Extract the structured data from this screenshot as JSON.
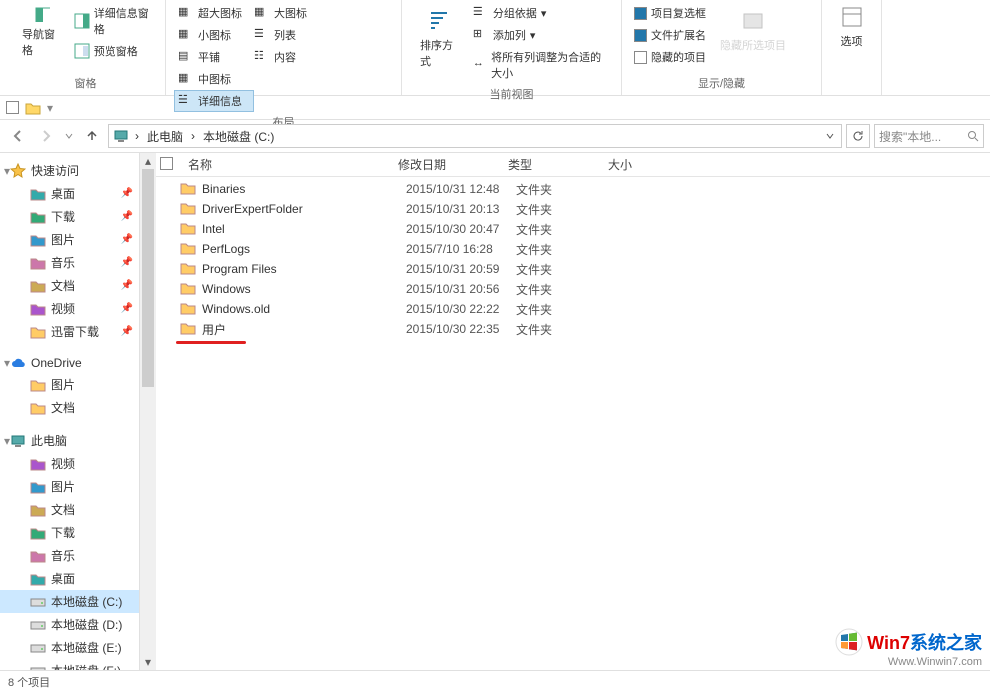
{
  "ribbon": {
    "panes": {
      "label": "窗格",
      "nav_pane": "导航窗格",
      "detail_pane": "详细信息窗格",
      "preview_pane": "预览窗格"
    },
    "layout": {
      "label": "布局",
      "xl_icons": "超大图标",
      "l_icons": "大图标",
      "m_icons": "中图标",
      "s_icons": "小图标",
      "list": "列表",
      "details": "详细信息",
      "tiles": "平铺",
      "content": "内容"
    },
    "view": {
      "label": "当前视图",
      "sort": "排序方式",
      "group": "分组依据",
      "add_col": "添加列",
      "fit_cols": "将所有列调整为合适的大小"
    },
    "showhide": {
      "label": "显示/隐藏",
      "item_chk": "项目复选框",
      "ext": "文件扩展名",
      "hidden": "隐藏的项目",
      "hide": "隐藏所选项目"
    },
    "options": {
      "label": "选项"
    }
  },
  "breadcrumb": {
    "pc": "此电脑",
    "disk": "本地磁盘 (C:)"
  },
  "search": {
    "placeholder": "搜索\"本地..."
  },
  "columns": {
    "name": "名称",
    "date": "修改日期",
    "type": "类型",
    "size": "大小"
  },
  "rows": [
    {
      "name": "Binaries",
      "date": "2015/10/31 12:48",
      "type": "文件夹"
    },
    {
      "name": "DriverExpertFolder",
      "date": "2015/10/31 20:13",
      "type": "文件夹"
    },
    {
      "name": "Intel",
      "date": "2015/10/30 20:47",
      "type": "文件夹"
    },
    {
      "name": "PerfLogs",
      "date": "2015/7/10 16:28",
      "type": "文件夹"
    },
    {
      "name": "Program Files",
      "date": "2015/10/31 20:59",
      "type": "文件夹"
    },
    {
      "name": "Windows",
      "date": "2015/10/31 20:56",
      "type": "文件夹"
    },
    {
      "name": "Windows.old",
      "date": "2015/10/30 22:22",
      "type": "文件夹"
    },
    {
      "name": "用户",
      "date": "2015/10/30 22:35",
      "type": "文件夹"
    }
  ],
  "nav": {
    "quick": "快速访问",
    "quick_items": [
      {
        "label": "桌面",
        "icon": "desktop",
        "pin": true
      },
      {
        "label": "下载",
        "icon": "download",
        "pin": true
      },
      {
        "label": "图片",
        "icon": "pictures",
        "pin": true
      },
      {
        "label": "音乐",
        "icon": "music",
        "pin": true
      },
      {
        "label": "文档",
        "icon": "docs",
        "pin": true
      },
      {
        "label": "视频",
        "icon": "video",
        "pin": true
      },
      {
        "label": "迅雷下载",
        "icon": "folder",
        "pin": true
      }
    ],
    "onedrive": "OneDrive",
    "onedrive_items": [
      {
        "label": "图片",
        "icon": "folder"
      },
      {
        "label": "文档",
        "icon": "folder"
      }
    ],
    "thispc": "此电脑",
    "thispc_items": [
      {
        "label": "视频",
        "icon": "video"
      },
      {
        "label": "图片",
        "icon": "pictures"
      },
      {
        "label": "文档",
        "icon": "docs"
      },
      {
        "label": "下载",
        "icon": "download"
      },
      {
        "label": "音乐",
        "icon": "music"
      },
      {
        "label": "桌面",
        "icon": "desktop"
      },
      {
        "label": "本地磁盘 (C:)",
        "icon": "disk",
        "selected": true
      },
      {
        "label": "本地磁盘 (D:)",
        "icon": "disk"
      },
      {
        "label": "本地磁盘 (E:)",
        "icon": "disk"
      },
      {
        "label": "本地磁盘 (F:)",
        "icon": "disk"
      }
    ]
  },
  "status": {
    "count": "8 个项目"
  },
  "watermark": {
    "line1a": "Win7",
    "line1b": "系统之家",
    "line2": "Www.Winwin7.com"
  }
}
